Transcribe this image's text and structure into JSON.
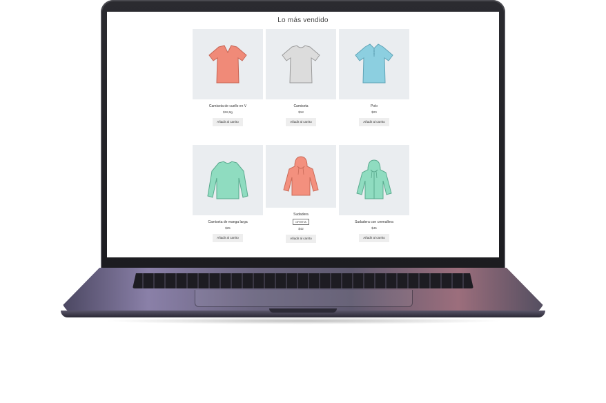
{
  "page": {
    "title": "Lo más vendido"
  },
  "products": [
    {
      "name": "Camiseta de cuello en V",
      "price": "$18,9g",
      "button": "Añadir al carrito",
      "color": "#f08a78",
      "icon": "vneck-tshirt-icon"
    },
    {
      "name": "Camiseta",
      "price": "$18",
      "button": "Añadir al carrito",
      "color": "#d6d6d6",
      "icon": "tshirt-icon"
    },
    {
      "name": "Polo",
      "price": "$20",
      "button": "Añadir al carrito",
      "color": "#8ccfe0",
      "icon": "polo-shirt-icon"
    },
    {
      "name": "Camiseta de manga larga",
      "price": "$25",
      "button": "Añadir al carrito",
      "color": "#8fdcc0",
      "icon": "long-sleeve-shirt-icon"
    },
    {
      "name": "Sudadera",
      "sale": "OFERTA",
      "price": "$42",
      "button": "Añadir al carrito",
      "color": "#f3907e",
      "icon": "hoodie-icon"
    },
    {
      "name": "Sudadera con cremallera",
      "price": "$45",
      "button": "Añadir al carrito",
      "color": "#8fdcc0",
      "icon": "zip-hoodie-icon"
    }
  ]
}
